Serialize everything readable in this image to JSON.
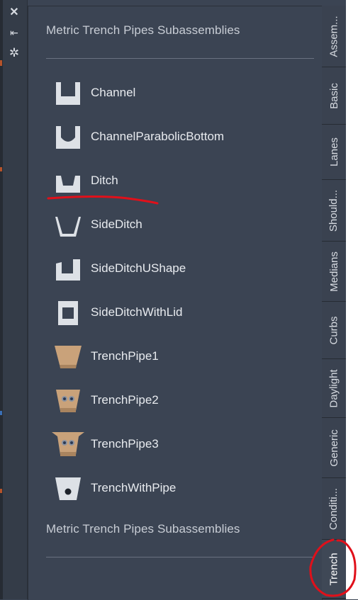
{
  "window": {
    "close_glyph": "✕",
    "pin_glyph": "⇤",
    "settings_glyph": "✲"
  },
  "palette": {
    "section_title": "Metric Trench Pipes Subassemblies",
    "footer_title": "Metric Trench Pipes Subassemblies",
    "items": [
      {
        "label": "Channel",
        "icon": "channel-icon"
      },
      {
        "label": "ChannelParabolicBottom",
        "icon": "channel-parabolic-bottom-icon"
      },
      {
        "label": "Ditch",
        "icon": "ditch-icon"
      },
      {
        "label": "SideDitch",
        "icon": "side-ditch-icon"
      },
      {
        "label": "SideDitchUShape",
        "icon": "side-ditch-ushape-icon"
      },
      {
        "label": "SideDitchWithLid",
        "icon": "side-ditch-with-lid-icon"
      },
      {
        "label": "TrenchPipe1",
        "icon": "trench-pipe1-icon"
      },
      {
        "label": "TrenchPipe2",
        "icon": "trench-pipe2-icon"
      },
      {
        "label": "TrenchPipe3",
        "icon": "trench-pipe3-icon"
      },
      {
        "label": "TrenchWithPipe",
        "icon": "trench-with-pipe-icon"
      }
    ]
  },
  "tabs": [
    {
      "label": "Assem..."
    },
    {
      "label": "Basic"
    },
    {
      "label": "Lanes"
    },
    {
      "label": "Should..."
    },
    {
      "label": "Medians"
    },
    {
      "label": "Curbs"
    },
    {
      "label": "Daylight"
    },
    {
      "label": "Generic"
    },
    {
      "label": "Conditi..."
    },
    {
      "label": "Trench",
      "active": true
    }
  ],
  "colors": {
    "panel_bg": "#3b4453",
    "icon_light": "#dde1e6",
    "icon_tan": "#c9a27a",
    "annotation": "#e0101a"
  }
}
